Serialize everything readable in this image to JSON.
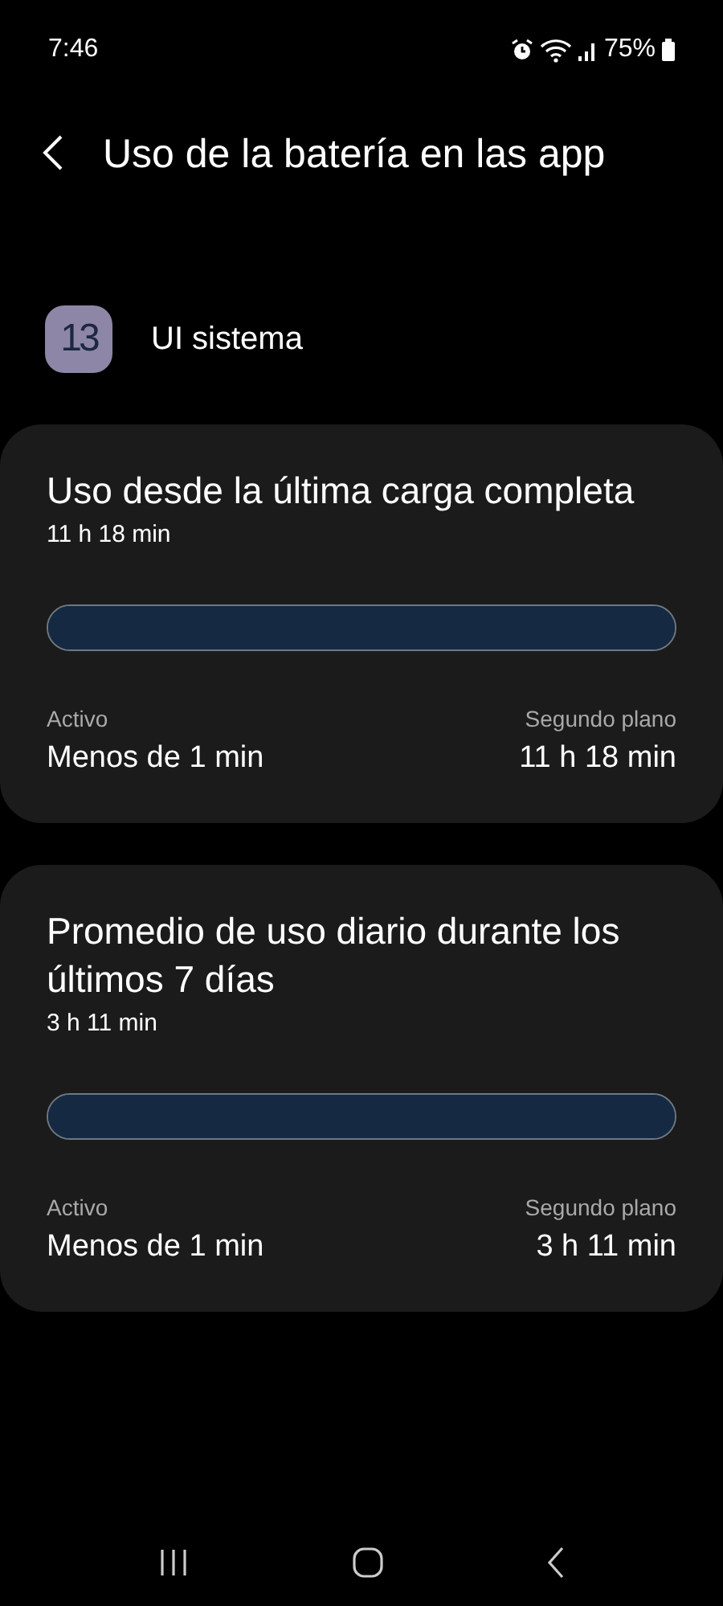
{
  "status_bar": {
    "time": "7:46",
    "battery": "75%"
  },
  "header": {
    "title": "Uso de la batería en las app"
  },
  "app": {
    "icon_text": "13",
    "name": "UI sistema"
  },
  "cards": [
    {
      "title": "Uso desde la última carga completa",
      "total": "11 h 18 min",
      "level": 1,
      "active_label": "Activo",
      "active_value": "Menos de 1 min",
      "background_label": "Segundo plano",
      "background_value": "11 h 18 min"
    },
    {
      "title": "Promedio de uso diario durante los últimos 7 días",
      "total": "3 h 11 min",
      "level": 1,
      "active_label": "Activo",
      "active_value": "Menos de 1 min",
      "background_label": "Segundo plano",
      "background_value": "3 h 11 min"
    }
  ]
}
